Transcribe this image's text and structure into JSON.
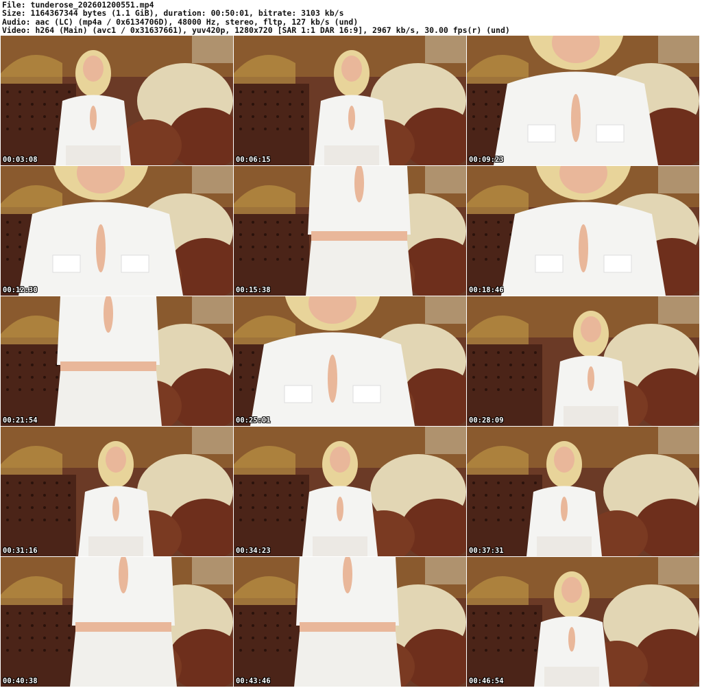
{
  "header": {
    "file": "File: tunderose_202601200551.mp4",
    "size": "Size: 1164367344 bytes (1.1 GiB), duration: 00:50:01, bitrate: 3103 kb/s",
    "audio": "Audio: aac (LC) (mp4a / 0x6134706D), 48000 Hz, stereo, fltp, 127 kb/s (und)",
    "video": "Video: h264 (Main) (avc1 / 0x31637661), yuv420p, 1280x720 [SAR 1:1 DAR 16:9], 2967 kb/s, 30.00 fps(r) (und)"
  },
  "thumbnails": [
    {
      "time": "00:03:08",
      "shot": "wide"
    },
    {
      "time": "00:06:15",
      "shot": "wide"
    },
    {
      "time": "00:09:23",
      "shot": "close"
    },
    {
      "time": "00:12:30",
      "shot": "close"
    },
    {
      "time": "00:15:38",
      "shot": "torso"
    },
    {
      "time": "00:18:46",
      "shot": "close"
    },
    {
      "time": "00:21:54",
      "shot": "torso"
    },
    {
      "time": "00:25:01",
      "shot": "close"
    },
    {
      "time": "00:28:09",
      "shot": "wide"
    },
    {
      "time": "00:31:16",
      "shot": "wide"
    },
    {
      "time": "00:34:23",
      "shot": "wide"
    },
    {
      "time": "00:37:31",
      "shot": "wide"
    },
    {
      "time": "00:40:38",
      "shot": "torso"
    },
    {
      "time": "00:43:46",
      "shot": "torso"
    },
    {
      "time": "00:46:54",
      "shot": "wide"
    }
  ],
  "colors": {
    "wall": "#6b3a26",
    "gold": "#c9a24a",
    "sofa": "#e2d6b4",
    "leather": "#6e2f1c",
    "shirt": "#f4f4f2",
    "skin": "#e9b79a",
    "hair": "#e8d49a"
  }
}
